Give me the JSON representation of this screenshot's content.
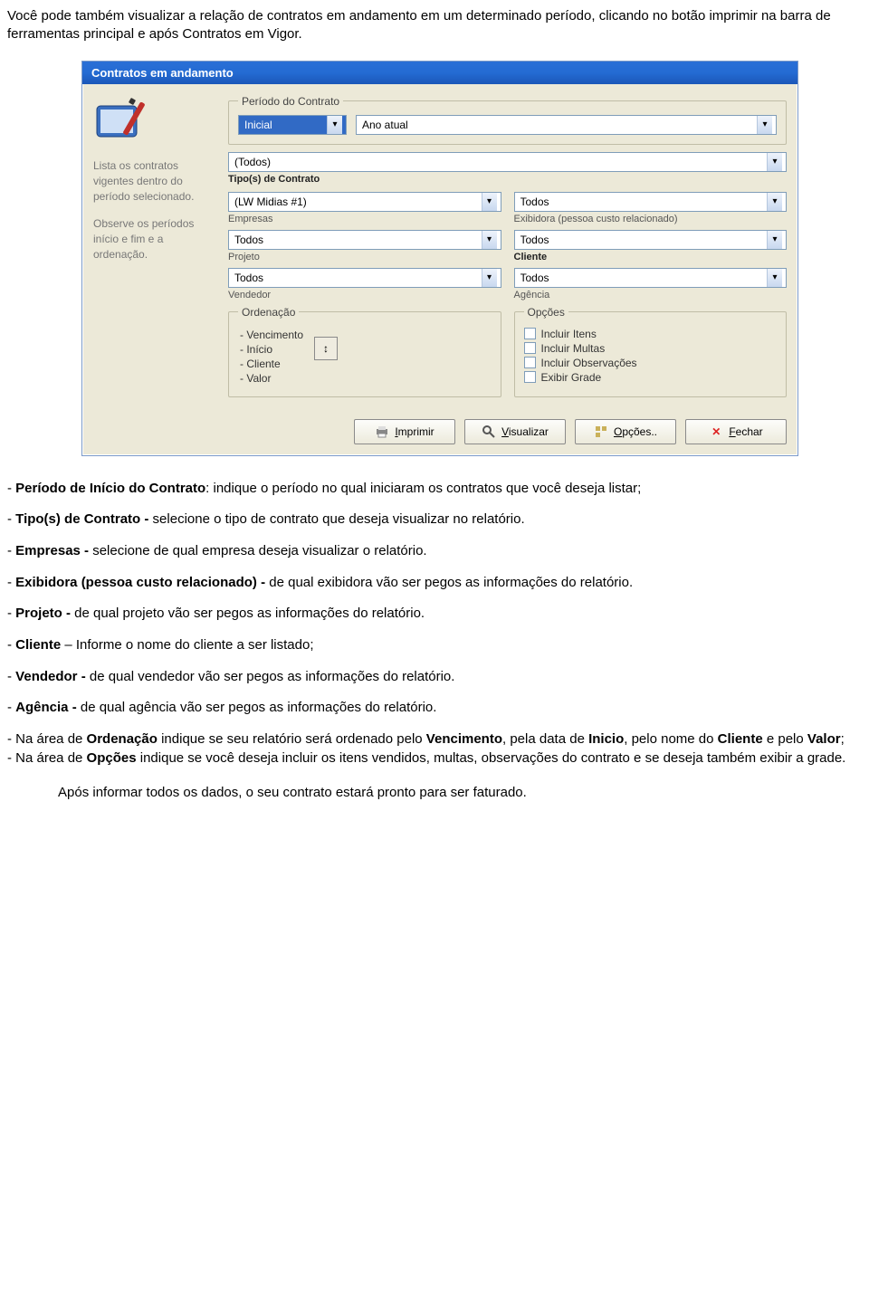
{
  "intro": "Você pode também visualizar a relação de contratos em andamento em um determinado período, clicando no botão imprimir na barra de ferramentas principal e após Contratos em Vigor.",
  "dialog": {
    "title": "Contratos em andamento",
    "sidebar": {
      "desc1": "Lista os contratos vigentes dentro do período selecionado.",
      "desc2": "Observe os períodos início e fim e a ordenação."
    },
    "period_group": {
      "legend": "Período do Contrato",
      "combo1": "Inicial",
      "combo2": "Ano atual"
    },
    "tipo": {
      "value": "(Todos)",
      "label": "Tipo(s) de Contrato"
    },
    "empresas": {
      "value": "(LW Midias #1)",
      "label": "Empresas"
    },
    "exibidora": {
      "value": "Todos",
      "label": "Exibidora (pessoa custo relacionado)"
    },
    "projeto": {
      "value": "Todos",
      "label": "Projeto"
    },
    "cliente": {
      "value": "Todos",
      "label": "Cliente"
    },
    "vendedor": {
      "value": "Todos",
      "label": "Vendedor"
    },
    "agencia": {
      "value": "Todos",
      "label": "Agência"
    },
    "ord": {
      "legend": "Ordenação",
      "items": [
        "- Vencimento",
        "- Início",
        "- Cliente",
        "- Valor"
      ]
    },
    "opts": {
      "legend": "Opções",
      "items": [
        "Incluir Itens",
        "Incluir Multas",
        "Incluir Observações",
        "Exibir Grade"
      ]
    },
    "buttons": {
      "imprimir": "Imprimir",
      "visualizar": "Visualizar",
      "opcoes": "Opções..",
      "fechar": "Fechar"
    }
  },
  "body": {
    "p_periodo_a": "- ",
    "p_periodo_b": "Período de Início do Contrato",
    "p_periodo_c": ": indique o período no qual iniciaram os contratos que você deseja listar;",
    "p_tipo_a": "- ",
    "p_tipo_b": "Tipo(s) de Contrato -",
    "p_tipo_c": " selecione o tipo de contrato que deseja visualizar no relatório.",
    "p_emp_a": "- ",
    "p_emp_b": "Empresas -",
    "p_emp_c": " selecione de qual empresa deseja visualizar o relatório.",
    "p_exi_a": "- ",
    "p_exi_b": "Exibidora (pessoa custo relacionado) -",
    "p_exi_c": " de qual exibidora vão ser pegos as informações do relatório.",
    "p_proj_a": "- ",
    "p_proj_b": "Projeto -",
    "p_proj_c": " de qual projeto vão ser pegos as informações do relatório.",
    "p_cli_a": "- ",
    "p_cli_b": "Cliente",
    "p_cli_c": " – Informe o nome do cliente a ser listado;",
    "p_ven_a": "- ",
    "p_ven_b": "Vendedor -",
    "p_ven_c": " de qual vendedor vão ser pegos as informações do relatório.",
    "p_age_a": "- ",
    "p_age_b": "Agência -",
    "p_age_c": " de qual agência vão ser pegos as informações do relatório.",
    "p_ord_1a": "- Na área de ",
    "p_ord_1b": "Ordenação",
    "p_ord_1c": " indique se seu relatório será ordenado pelo ",
    "p_ord_1d": "Vencimento",
    "p_ord_1e": ", pela data de ",
    "p_ord_1f": "Inicio",
    "p_ord_1g": ", pelo nome do ",
    "p_ord_1h": "Cliente",
    "p_ord_1i": " e pelo ",
    "p_ord_1j": "Valor",
    "p_ord_1k": ";",
    "p_opt_a": "- Na área de ",
    "p_opt_b": "Opções",
    "p_opt_c": " indique se você deseja incluir os itens vendidos, multas, observações do contrato e se deseja também exibir a grade.",
    "footer": "Após informar todos os dados, o seu contrato estará pronto para ser faturado."
  }
}
